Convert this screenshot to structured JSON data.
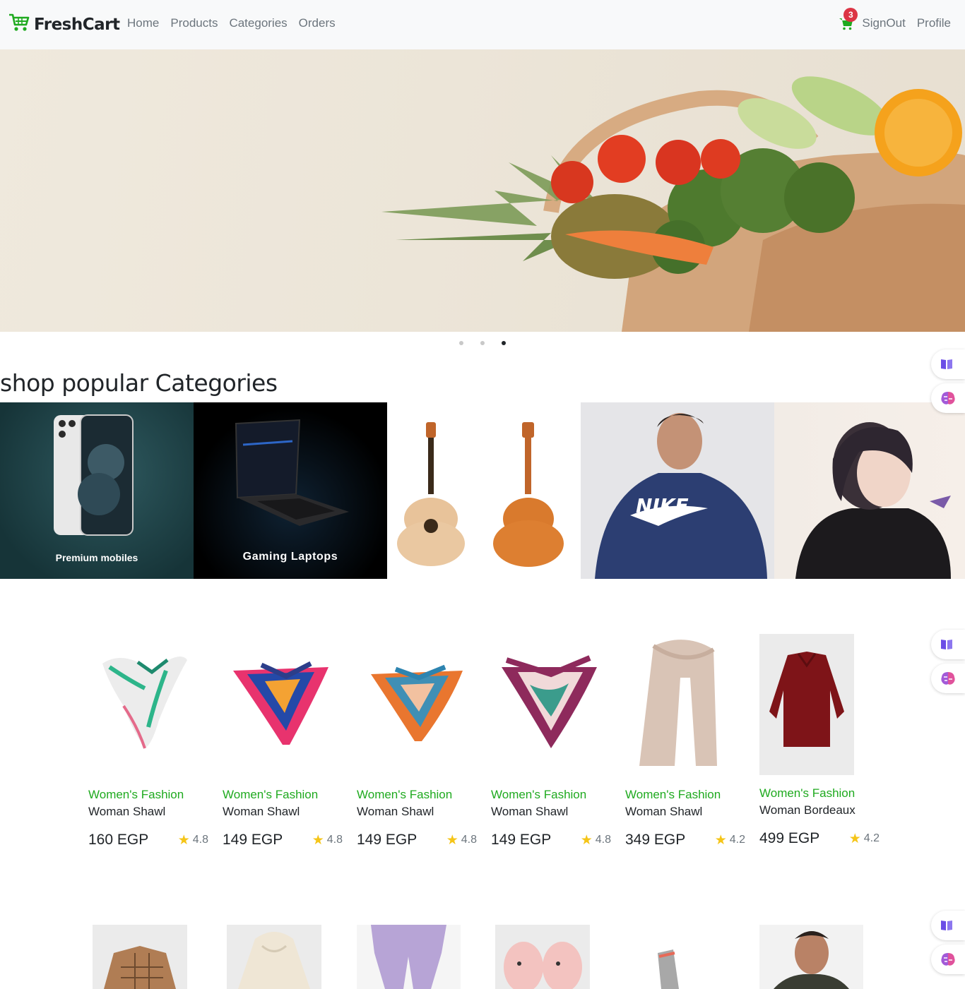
{
  "brand": {
    "name": "FreshCart",
    "color": "#1faa1f"
  },
  "nav": {
    "links": [
      "Home",
      "Products",
      "Categories",
      "Orders"
    ],
    "cart_count": "3",
    "signout": "SignOut",
    "profile": "Profile"
  },
  "slider": {
    "slides": 3,
    "active": 3
  },
  "categories": {
    "title": "shop popular Categories",
    "items": [
      {
        "label": "Premium mobiles"
      },
      {
        "label": "Gaming Laptops"
      },
      {
        "label": ""
      },
      {
        "label": ""
      },
      {
        "label": ""
      }
    ]
  },
  "products": [
    {
      "category": "Women's Fashion",
      "name": "Woman Shawl",
      "price": "160 EGP",
      "rating": "4.8"
    },
    {
      "category": "Women's Fashion",
      "name": "Woman Shawl",
      "price": "149 EGP",
      "rating": "4.8"
    },
    {
      "category": "Women's Fashion",
      "name": "Woman Shawl",
      "price": "149 EGP",
      "rating": "4.8"
    },
    {
      "category": "Women's Fashion",
      "name": "Woman Shawl",
      "price": "149 EGP",
      "rating": "4.8"
    },
    {
      "category": "Women's Fashion",
      "name": "Woman Shawl",
      "price": "349 EGP",
      "rating": "4.2"
    },
    {
      "category": "Women's Fashion",
      "name": "Woman Bordeaux",
      "price": "499 EGP",
      "rating": "4.2"
    }
  ],
  "icons": {
    "cart": "shopping-cart-icon",
    "star": "star-icon",
    "book": "book-icon",
    "brain": "brain-icon"
  }
}
